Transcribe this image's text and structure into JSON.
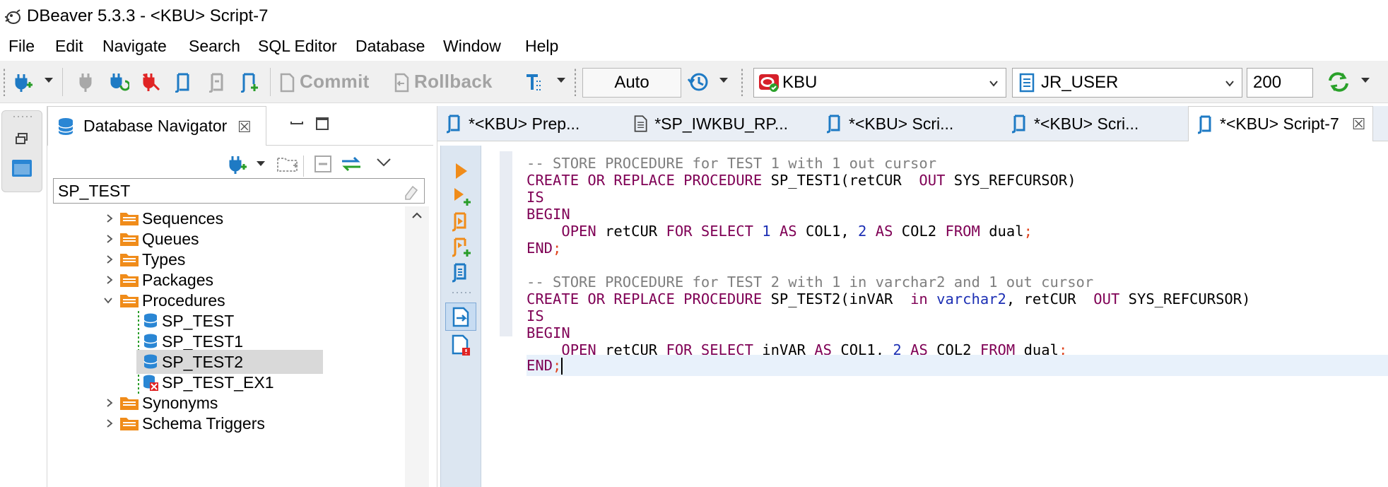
{
  "window": {
    "title": "DBeaver 5.3.3 - <KBU> Script-7"
  },
  "menu": [
    "File",
    "Edit",
    "Navigate",
    "Search",
    "SQL Editor",
    "Database",
    "Window",
    "Help"
  ],
  "toolbar": {
    "commit_label": "Commit",
    "rollback_label": "Rollback",
    "transaction_mode": "Auto",
    "connection": "KBU",
    "schema": "JR_USER",
    "result_limit": "200"
  },
  "navigator": {
    "tab_label": "Database Navigator",
    "filter_value": "SP_TEST",
    "tree": [
      {
        "label": "Sequences",
        "kind": "folder",
        "expanded": false
      },
      {
        "label": "Queues",
        "kind": "folder",
        "expanded": false
      },
      {
        "label": "Types",
        "kind": "folder",
        "expanded": false
      },
      {
        "label": "Packages",
        "kind": "folder",
        "expanded": false
      },
      {
        "label": "Procedures",
        "kind": "folder",
        "expanded": true
      },
      {
        "label": "SP_TEST",
        "kind": "procedure",
        "status": "valid"
      },
      {
        "label": "SP_TEST1",
        "kind": "procedure",
        "status": "valid"
      },
      {
        "label": "SP_TEST2",
        "kind": "procedure",
        "status": "valid",
        "selected": true
      },
      {
        "label": "SP_TEST_EX1",
        "kind": "procedure",
        "status": "error"
      },
      {
        "label": "Synonyms",
        "kind": "folder",
        "expanded": false
      },
      {
        "label": "Schema Triggers",
        "kind": "folder",
        "expanded": false
      }
    ]
  },
  "editor": {
    "tabs": [
      {
        "label": "*<KBU> Prep...",
        "active": false
      },
      {
        "label": "*SP_IWKBU_RP...",
        "active": false
      },
      {
        "label": "*<KBU> Scri...",
        "active": false
      },
      {
        "label": "*<KBU> Scri...",
        "active": false
      },
      {
        "label": "*<KBU> Script-7",
        "active": true
      }
    ],
    "code": {
      "l1": "-- STORE PROCEDURE for TEST 1 with 1 out cursor",
      "l2_kw": "CREATE OR REPLACE PROCEDURE",
      "l2_name": " SP_TEST1(retCUR  ",
      "l2_kw2": "OUT",
      "l2_rest": " SYS_REFCURSOR)",
      "is": "IS",
      "begin": "BEGIN",
      "l5_indent": "    ",
      "open": "OPEN",
      "retcur": " retCUR ",
      "for_select": "FOR SELECT",
      "one": "1",
      "as": "AS",
      "col1": " COL1, ",
      "two": "2",
      "col2": " COL2 ",
      "from": "FROM",
      "dual": " dual",
      "semi": ";",
      "end": "END",
      "l7": "-- STORE PROCEDURE for TEST 2 with 1 in varchar2 and 1 out cursor",
      "l8_name": " SP_TEST2(inVAR  ",
      "in": "in",
      "varchar2": "varchar2",
      "l8_mid": ", retCUR  ",
      "invar": " inVAR "
    }
  },
  "colors": {
    "keyword": "#7f0055",
    "type": "#1c2fb4",
    "comment": "#7f7f7f",
    "punct": "#e0451f",
    "folder": "#f08c1a",
    "accent_blue": "#2a7fd4"
  }
}
